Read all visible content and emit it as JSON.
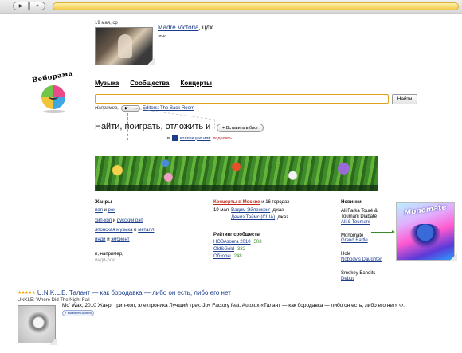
{
  "player": {
    "prev_label": "▶",
    "next_label": "+"
  },
  "featured": {
    "date": "19 мая, ср",
    "artist": "Madre Victoria",
    "artist_suffix": ", цдх",
    "genre": "этно"
  },
  "logo": {
    "text": "Веборама"
  },
  "tabs": [
    {
      "label": "Музыка"
    },
    {
      "label": "Сообщества"
    },
    {
      "label": "Концерты"
    }
  ],
  "search": {
    "value": "",
    "placeholder": "",
    "button_label": "Найти"
  },
  "example": {
    "label": "Например,",
    "link": "Editors: The Back Room"
  },
  "slogan": "Найти, поиграть, отложить и",
  "blog_button": "+ Вставить в блог",
  "collection": {
    "prefix": "в",
    "text": "коллекцию или",
    "share": "поделить"
  },
  "genres": {
    "header": "Жанры",
    "rows": [
      [
        {
          "t": "поп",
          "link": true
        },
        {
          "t": " и ",
          "link": false
        },
        {
          "t": "рок",
          "link": true
        }
      ],
      [
        {
          "t": "хип-хоп",
          "link": true
        },
        {
          "t": " и ",
          "link": false
        },
        {
          "t": "русский рэп",
          "link": true
        }
      ],
      [
        {
          "t": "японская музыка",
          "link": true
        },
        {
          "t": " и ",
          "link": false
        },
        {
          "t": "металл",
          "link": true
        }
      ],
      [
        {
          "t": "инди",
          "link": true
        },
        {
          "t": " и ",
          "link": false
        },
        {
          "t": "эмбиент",
          "link": true
        }
      ]
    ],
    "example_label": "и, например,",
    "example_value": "инди-рок"
  },
  "concerts": {
    "header_link": "Концерты в Москве",
    "header_rest": " и 16 городах",
    "events": [
      {
        "date": "19 мая",
        "artist": "Вадим Эйленкриг",
        "genre": "джаз"
      },
      {
        "date": "",
        "artist": "Дениз Таймс (США)",
        "genre": "джаз"
      }
    ],
    "rating_header": "Рейтинг сообществ",
    "ratings": [
      {
        "name": "НОВАзонга 2010",
        "count": "503"
      },
      {
        "name": "Old&Gold",
        "count": "332"
      },
      {
        "name": "Обзоры",
        "count": "248"
      }
    ]
  },
  "news": {
    "header": "Новинки",
    "items": [
      {
        "artist": "Ali Farka Touré & Toumani Diabaté",
        "album": "Ali & Toumani"
      },
      {
        "artist": "Monomate",
        "album": "Grand Battle"
      },
      {
        "artist": "Hole",
        "album": "Nobody's Daughter"
      },
      {
        "artist": "Smokey Bandits",
        "album": "Debut"
      }
    ],
    "cover_title": "Monomate"
  },
  "bottom": {
    "stars": "★★★★★",
    "title": "U.N.K.L.E. Талант — как бородавка — либо он есть, либо его нет",
    "subtitle": "UNKLE: Where Did The Night Fall",
    "description": "Mo' Wax, 2010 Жанр: трип-хоп, электроника Лучший трек: Joy Factory feat. Autolux «Талант — как бородавка — либо он есть, либо его нет» Ф.",
    "badge": "7 комментариев"
  }
}
